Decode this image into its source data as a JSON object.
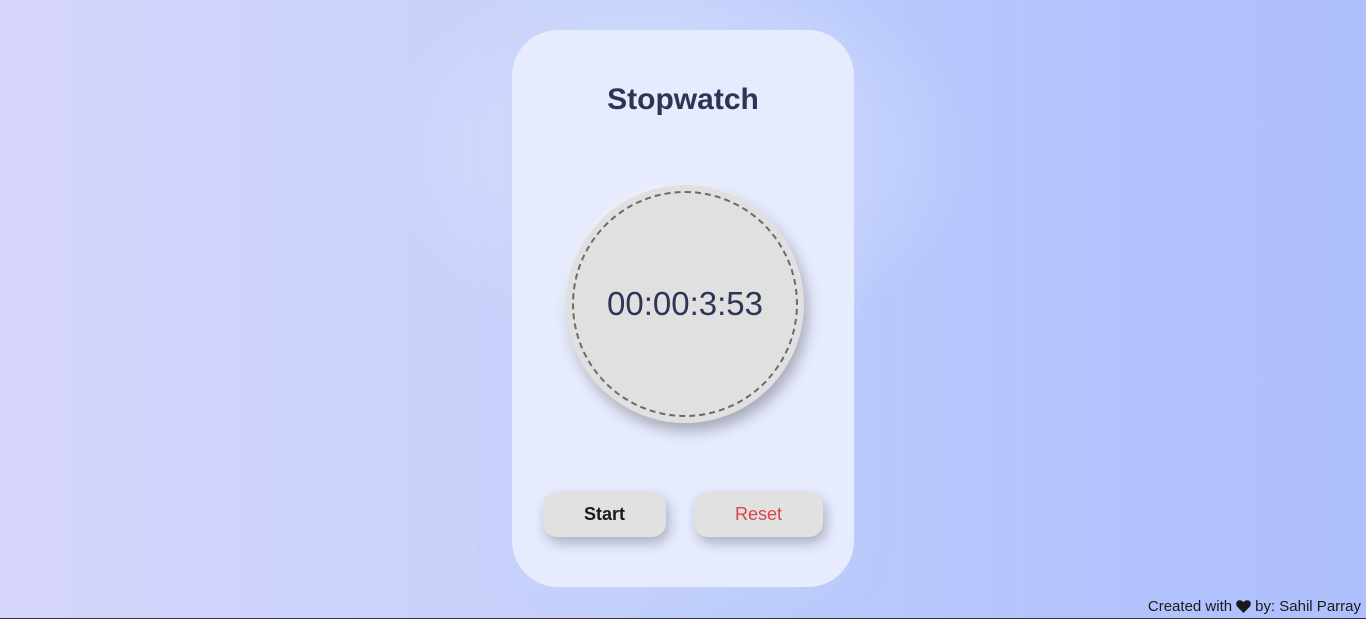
{
  "app": {
    "title": "Stopwatch"
  },
  "display": {
    "time": "00:00:3:53"
  },
  "controls": {
    "start_label": "Start",
    "reset_label": "Reset"
  },
  "footer": {
    "prefix": "Created with",
    "icon": "heart-icon",
    "suffix": "by: Sahil Parray"
  },
  "colors": {
    "card_background": "#e6ebfe",
    "title_text": "#2d3554",
    "dial_background": "#e0e0e1",
    "reset_text": "#d9454b"
  }
}
